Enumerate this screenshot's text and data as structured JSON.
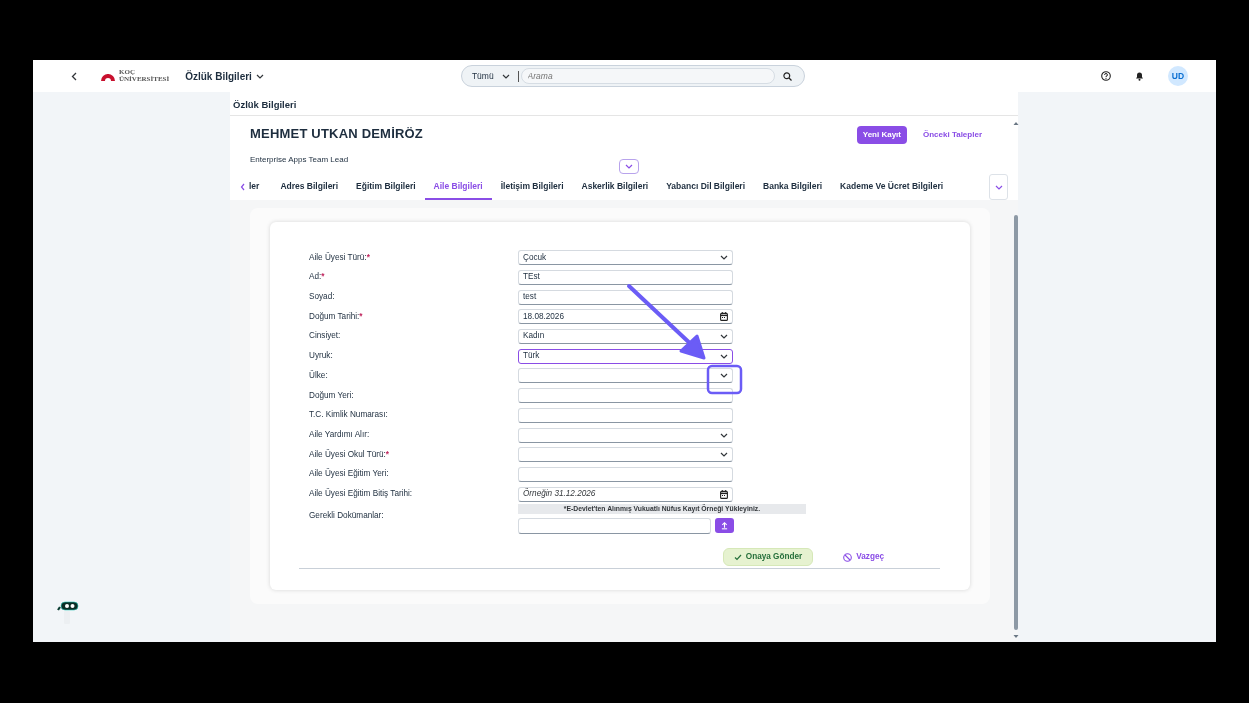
{
  "header": {
    "logo_line1": "KOÇ",
    "logo_line2": "ÜNİVERSİTESİ",
    "app_title": "Özlük Bilgileri",
    "search": {
      "scope": "Tümü",
      "placeholder": "Arama"
    },
    "avatar": "UD"
  },
  "page_title": "Özlük Bilgileri",
  "profile": {
    "name": "MEHMET UTKAN DEMİRÖZ",
    "role": "Enterprise Apps Team Lead",
    "new_button": "Yeni Kayıt",
    "history_link": "Önceki Talepler"
  },
  "tabs": [
    {
      "label": "ler",
      "selected": false
    },
    {
      "label": "Adres Bilgileri",
      "selected": false
    },
    {
      "label": "Eğitim Bilgileri",
      "selected": false
    },
    {
      "label": "Aile Bilgileri",
      "selected": true
    },
    {
      "label": "İletişim Bilgileri",
      "selected": false
    },
    {
      "label": "Askerlik Bilgileri",
      "selected": false
    },
    {
      "label": "Yabancı Dil Bilgileri",
      "selected": false
    },
    {
      "label": "Banka Bilgileri",
      "selected": false
    },
    {
      "label": "Kademe Ve Ücret Bilgileri",
      "selected": false
    }
  ],
  "form": {
    "required_mark": "*",
    "fields": [
      {
        "label": "Aile Üyesi Türü:",
        "required": true,
        "kind": "select",
        "value": "Çocuk",
        "focused": false
      },
      {
        "label": "Ad:",
        "required": true,
        "kind": "text",
        "value": "TEst",
        "focused": false
      },
      {
        "label": "Soyad:",
        "required": false,
        "kind": "text",
        "value": "test",
        "focused": false
      },
      {
        "label": "Doğum Tarihi:",
        "required": true,
        "kind": "date",
        "value": "18.08.2026",
        "focused": false
      },
      {
        "label": "Cinsiyet:",
        "required": false,
        "kind": "select",
        "value": "Kadın",
        "focused": false
      },
      {
        "label": "Uyruk:",
        "required": false,
        "kind": "select",
        "value": "Türk",
        "focused": true
      },
      {
        "label": "Ülke:",
        "required": false,
        "kind": "select",
        "focused": false
      },
      {
        "label": "Doğum Yeri:",
        "required": false,
        "kind": "text",
        "focused": false
      },
      {
        "label": "T.C. Kimlik Numarası:",
        "required": false,
        "kind": "text",
        "focused": false
      },
      {
        "label": "Aile Yardımı Alır:",
        "required": false,
        "kind": "select",
        "focused": false
      },
      {
        "label": "Aile Üyesi Okul Türü:",
        "required": true,
        "kind": "select",
        "focused": false
      },
      {
        "label": "Aile Üyesi Eğitim Yeri:",
        "required": false,
        "kind": "text",
        "focused": false
      },
      {
        "label": "Aile Üyesi Eğitim Bitiş Tarihi:",
        "required": false,
        "kind": "date",
        "placeholder": "Örneğin 31.12.2026",
        "focused": false
      }
    ],
    "documents": {
      "label": "Gerekli Dokümanlar:",
      "note": "*E-Devlet'ten Alınmış Vukuatlı Nüfus Kayıt Örneği Yükleyiniz."
    },
    "submit": "Onaya Gönder",
    "cancel": "Vazgeç"
  },
  "annotation": {
    "kind": "arrow"
  }
}
